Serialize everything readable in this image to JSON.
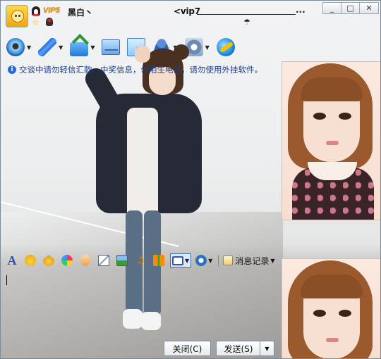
{
  "header": {
    "vip_badge": "VIP5",
    "nickname": "黑白丶",
    "signature": "<vip7",
    "signature_tail": "..."
  },
  "toolbar": {
    "items": [
      {
        "icon": "video-camera-icon",
        "has_dropdown": true
      },
      {
        "icon": "microphone-icon",
        "has_dropdown": true
      },
      {
        "icon": "send-file-icon",
        "has_dropdown": true
      },
      {
        "icon": "email-icon",
        "has_dropdown": false
      },
      {
        "icon": "share-doc-icon",
        "has_dropdown": false
      },
      {
        "icon": "invite-user-icon",
        "has_dropdown": true
      },
      {
        "icon": "app-settings-icon",
        "has_dropdown": true
      },
      {
        "icon": "internet-icon",
        "has_dropdown": false
      }
    ]
  },
  "notice": {
    "text": "交谈中请勿轻信汇款、中奖信息，勿陌生电话，请勿使用外挂软件。"
  },
  "format_bar": {
    "font_label": "A",
    "history_label": "消息记录"
  },
  "buttons": {
    "close_label": "关闭(C)",
    "send_label": "发送(S)",
    "send_dropdown": "▼"
  },
  "window_controls": {
    "minimize": "_",
    "maximize": "□",
    "close": "✕"
  },
  "colors": {
    "notice_text": "#1a3f8f",
    "vip_gold": "#e0a000"
  }
}
